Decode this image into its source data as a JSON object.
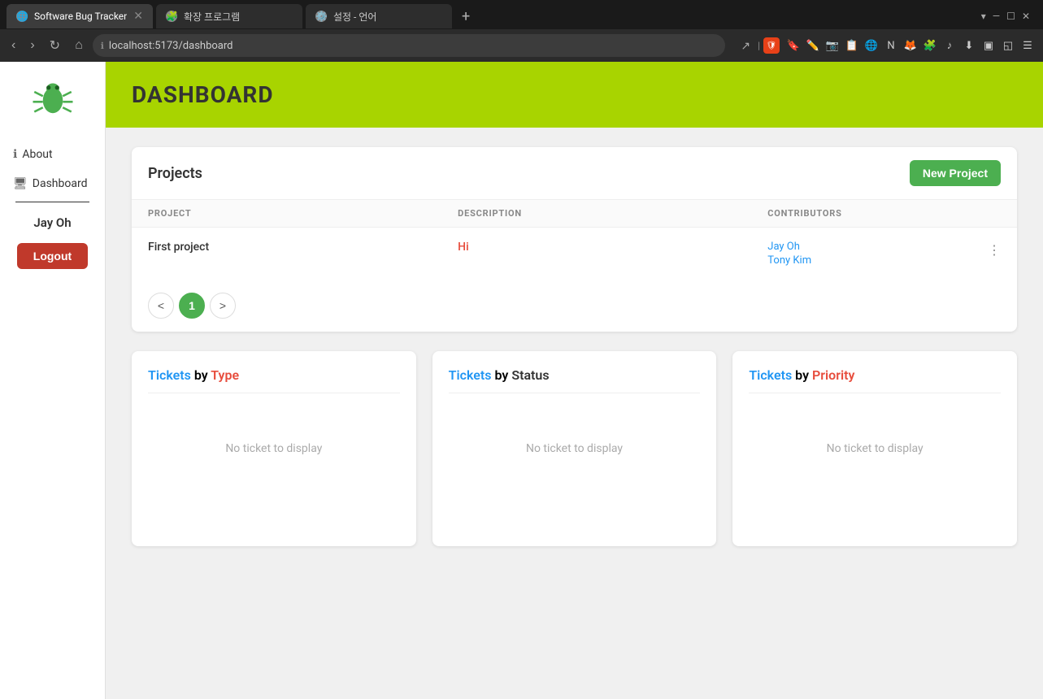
{
  "browser": {
    "tabs": [
      {
        "id": "tab1",
        "title": "Software Bug Tracker",
        "url": "localhost:5173/dashboard",
        "active": true,
        "favicon": "🌐"
      },
      {
        "id": "tab2",
        "title": "확장 프로그램",
        "active": false,
        "favicon": "🧩"
      },
      {
        "id": "tab3",
        "title": "설정 - 언어",
        "active": false,
        "favicon": "⚙️"
      }
    ],
    "url": "localhost:5173/dashboard",
    "add_tab_label": "+"
  },
  "sidebar": {
    "logo_alt": "Bug Tracker Logo",
    "nav_items": [
      {
        "id": "about",
        "label": "About",
        "icon": "ℹ️"
      },
      {
        "id": "dashboard",
        "label": "Dashboard",
        "icon": "🖥"
      }
    ],
    "username": "Jay Oh",
    "logout_label": "Logout"
  },
  "page": {
    "title": "DASHBOARD"
  },
  "projects": {
    "section_title": "Projects",
    "new_project_label": "New Project",
    "columns": [
      "PROJECT",
      "DESCRIPTION",
      "CONTRIBUTORS"
    ],
    "rows": [
      {
        "project": "First project",
        "description": "Hi",
        "contributors": [
          "Jay Oh",
          "Tony Kim"
        ]
      }
    ],
    "pagination": {
      "prev": "<",
      "current": "1",
      "next": ">"
    }
  },
  "charts": [
    {
      "id": "by-type",
      "title_word1": "Tickets",
      "title_by": " by ",
      "title_word2": "Type",
      "empty_message": "No ticket to display"
    },
    {
      "id": "by-status",
      "title_word1": "Tickets",
      "title_by": " by ",
      "title_word2": "Status",
      "empty_message": "No ticket to display"
    },
    {
      "id": "by-priority",
      "title_word1": "Tickets",
      "title_by": " by ",
      "title_word2": "Priority",
      "empty_message": "No ticket to display"
    }
  ]
}
